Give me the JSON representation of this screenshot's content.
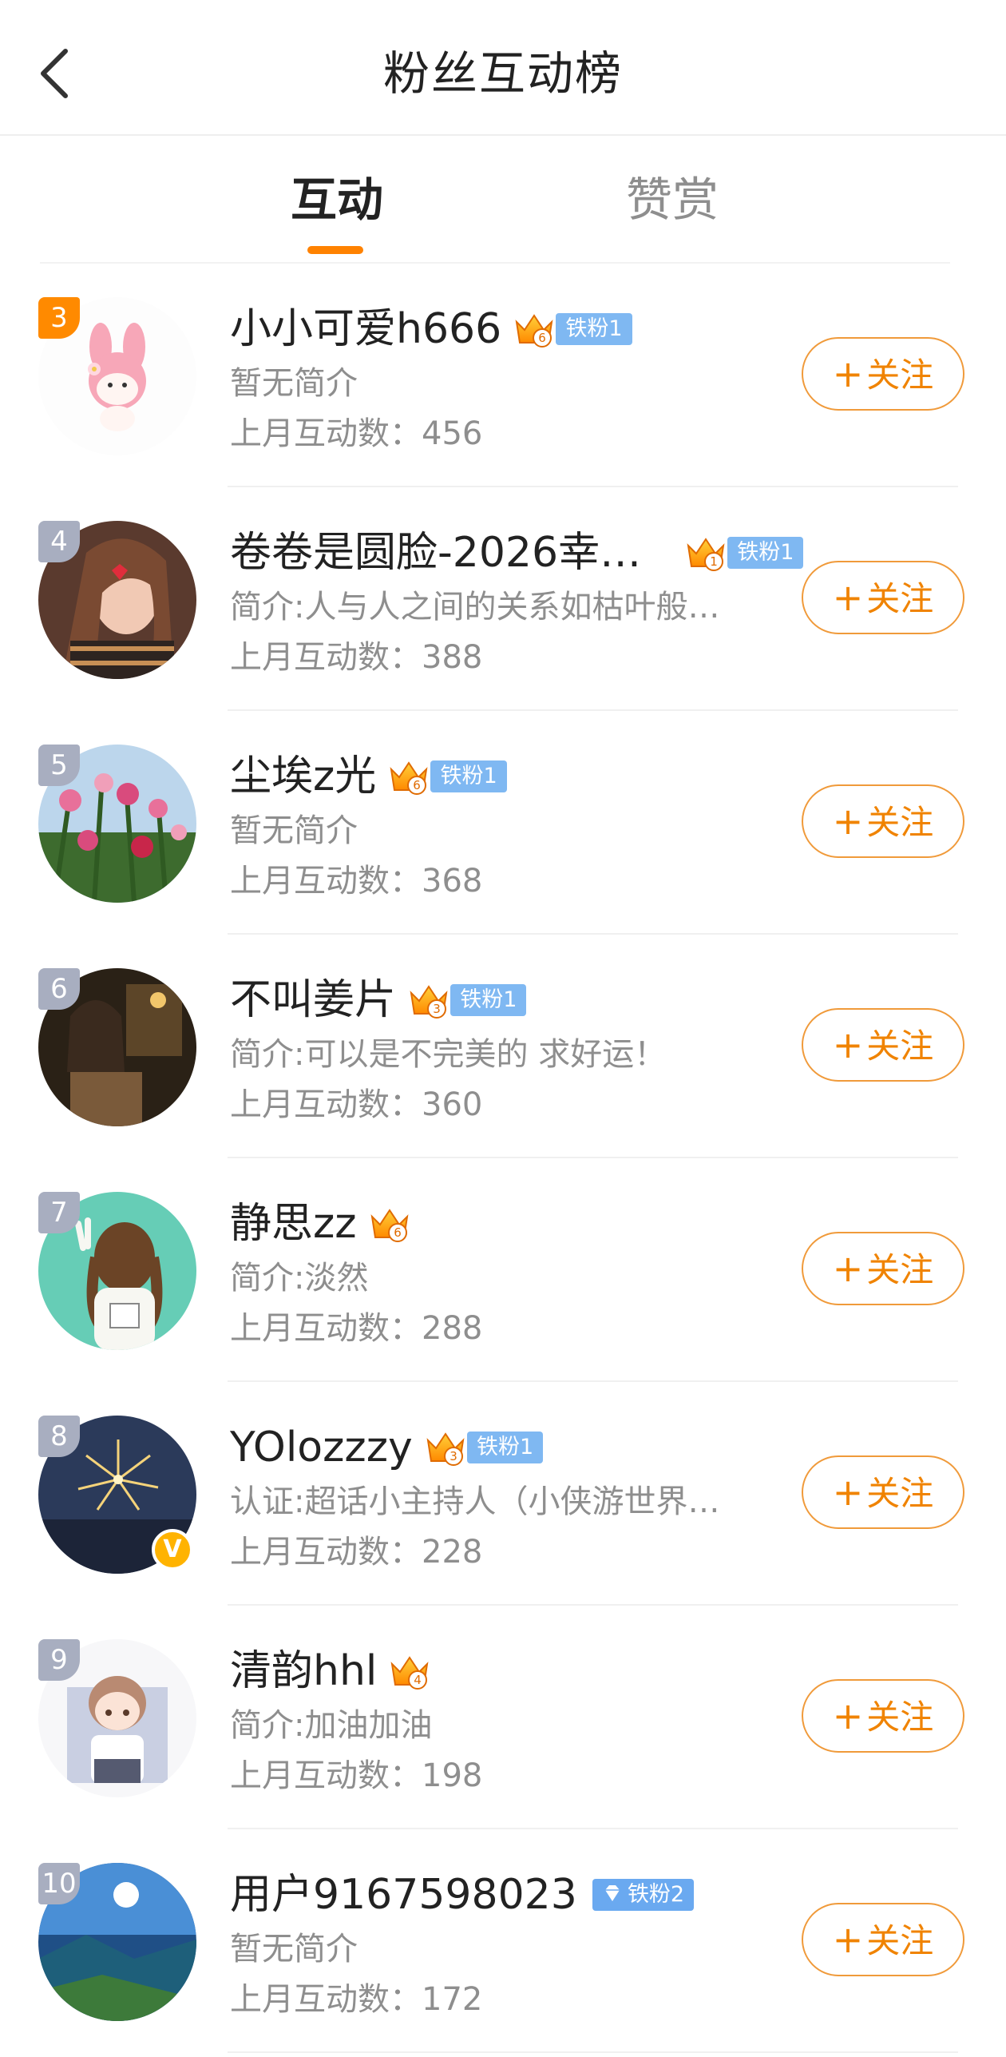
{
  "header": {
    "title": "粉丝互动榜",
    "back_icon": "chevron-left-icon"
  },
  "tabs": [
    {
      "label": "互动",
      "active": true
    },
    {
      "label": "赞赏",
      "active": false
    }
  ],
  "colors": {
    "accent": "#ff8200",
    "tag_blue": "#7fb8f2",
    "rank_gray": "#a8aec0",
    "rank_orange": "#ff8a00",
    "verified": "#ffb300"
  },
  "follow_label": "关注",
  "users": [
    {
      "rank": "3",
      "name": "小小可爱h666",
      "crown": "6",
      "tag": "铁粉1",
      "bio": "暂无简介",
      "count": "上月互动数：456"
    },
    {
      "rank": "4",
      "name": "卷卷是圆脸-2026幸…",
      "crown": "1",
      "tag": "铁粉1",
      "bio": "简介:人与人之间的关系如枯叶般…",
      "count": "上月互动数：388"
    },
    {
      "rank": "5",
      "name": "尘埃z光",
      "crown": "6",
      "tag": "铁粉1",
      "bio": "暂无简介",
      "count": "上月互动数：368"
    },
    {
      "rank": "6",
      "name": "不叫姜片",
      "crown": "3",
      "tag": "铁粉1",
      "bio": "简介:可以是不完美的 求好运！",
      "count": "上月互动数：360"
    },
    {
      "rank": "7",
      "name": "静思zz",
      "crown": "6",
      "tag": "",
      "bio": "简介:淡然",
      "count": "上月互动数：288"
    },
    {
      "rank": "8",
      "name": "YOlozzzy",
      "crown": "3",
      "tag": "铁粉1",
      "bio": "认证:超话小主持人（小侠游世界…",
      "count": "上月互动数：228",
      "verified": "V"
    },
    {
      "rank": "9",
      "name": "清韵hhl",
      "crown": "4",
      "tag": "",
      "bio": "简介:加油加油",
      "count": "上月互动数：198"
    },
    {
      "rank": "10",
      "name": "用户9167598023",
      "crown": "",
      "tag": "铁粉2",
      "tag_icon": "diamond-icon",
      "bio": "暂无简介",
      "count": "上月互动数：172"
    }
  ]
}
